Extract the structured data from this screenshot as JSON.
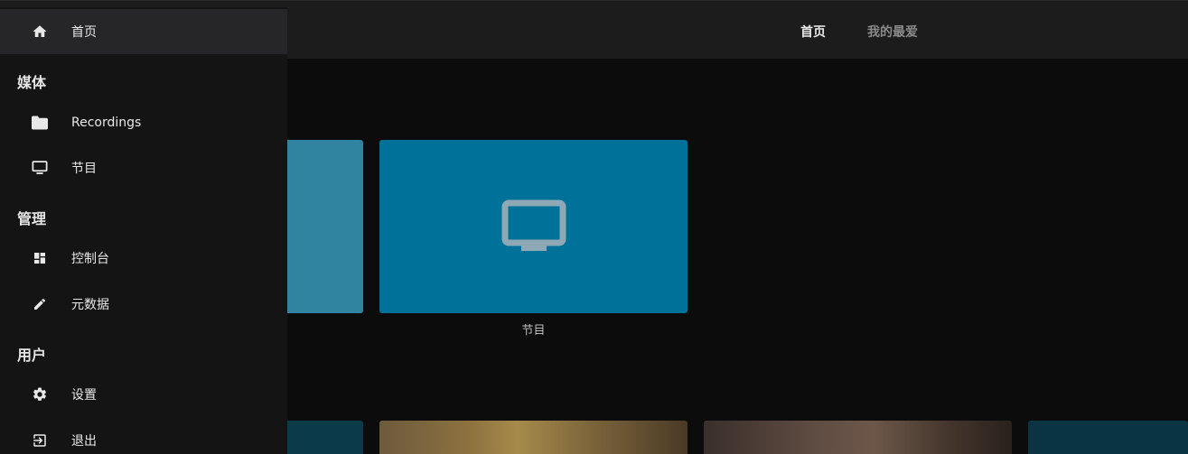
{
  "header": {
    "tabs": [
      {
        "label": "首页",
        "active": true
      },
      {
        "label": "我的最爱",
        "active": false
      }
    ]
  },
  "library": {
    "tiles": [
      {
        "name": "Recordings",
        "color": "#31849f"
      },
      {
        "name": "节目",
        "color": "#00729a",
        "icon": "tv-icon"
      }
    ],
    "caption": "节目"
  },
  "drawer": {
    "home": {
      "label": "首页",
      "icon": "home-icon"
    },
    "sections": [
      {
        "title": "媒体",
        "items": [
          {
            "label": "Recordings",
            "icon": "folder-icon"
          },
          {
            "label": "节目",
            "icon": "tv-icon"
          }
        ]
      },
      {
        "title": "管理",
        "items": [
          {
            "label": "控制台",
            "icon": "dashboard-icon"
          },
          {
            "label": "元数据",
            "icon": "pencil-icon"
          }
        ]
      },
      {
        "title": "用户",
        "items": [
          {
            "label": "设置",
            "icon": "gear-icon"
          },
          {
            "label": "退出",
            "icon": "logout-icon"
          }
        ]
      }
    ]
  },
  "colors": {
    "background": "#0c0c0c",
    "drawer": "#141414",
    "active_item": "#262628",
    "accent": "#00729a"
  }
}
